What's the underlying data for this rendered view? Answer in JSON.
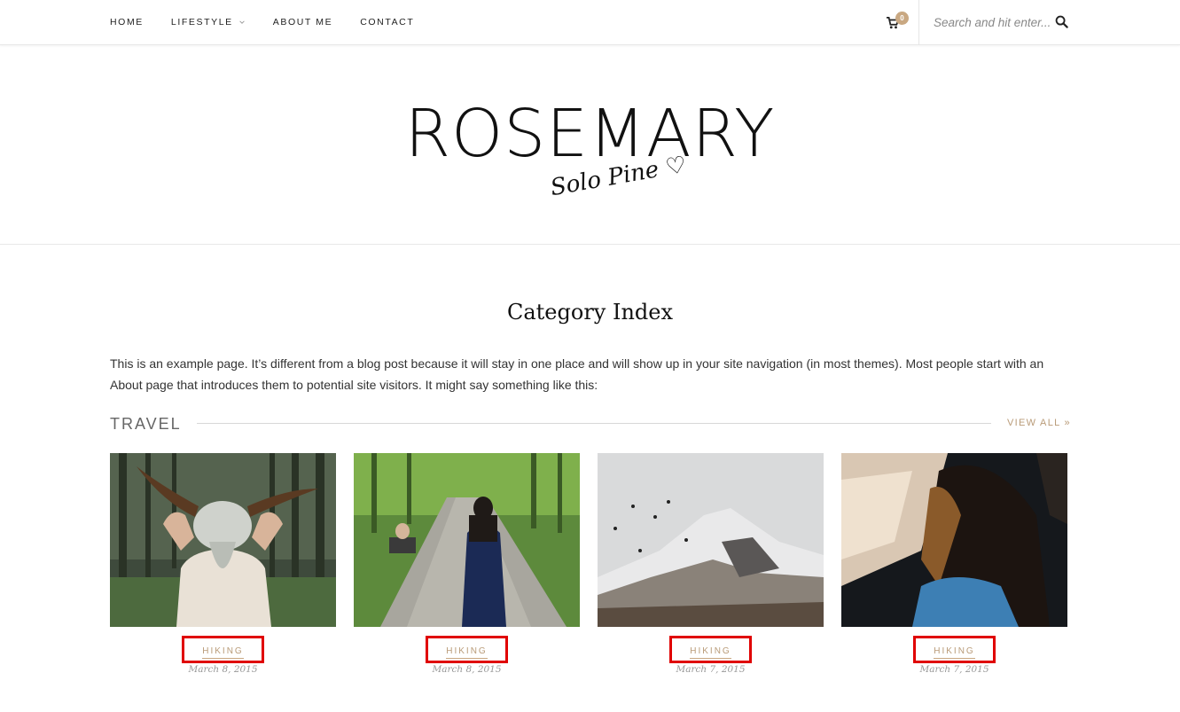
{
  "nav": {
    "items": [
      "HOME",
      "LIFESTYLE",
      "ABOUT ME",
      "CONTACT"
    ],
    "cart_count": "0",
    "search_placeholder": "Search and hit enter..."
  },
  "header": {
    "logo_main": "ROSEMARY",
    "logo_sub": "Solo Pine"
  },
  "page": {
    "title": "Category Index",
    "intro": "This is an example page. It’s different from a blog post because it will stay in one place and will show up in your site navigation (in most themes). Most people start with an About page that introduces them to potential site visitors. It might say something like this:"
  },
  "section": {
    "title": "TRAVEL",
    "view_all": "VIEW ALL »"
  },
  "cards": [
    {
      "category": "HIKING",
      "date": "March 8, 2015",
      "image": "woman-holding-skull"
    },
    {
      "category": "HIKING",
      "date": "March 8, 2015",
      "image": "woman-on-park-path"
    },
    {
      "category": "HIKING",
      "date": "March 7, 2015",
      "image": "snowy-mountain-birds"
    },
    {
      "category": "HIKING",
      "date": "March 7, 2015",
      "image": "woman-in-car"
    }
  ],
  "colors": {
    "accent": "#b99b78",
    "highlight_box": "#e00000"
  }
}
